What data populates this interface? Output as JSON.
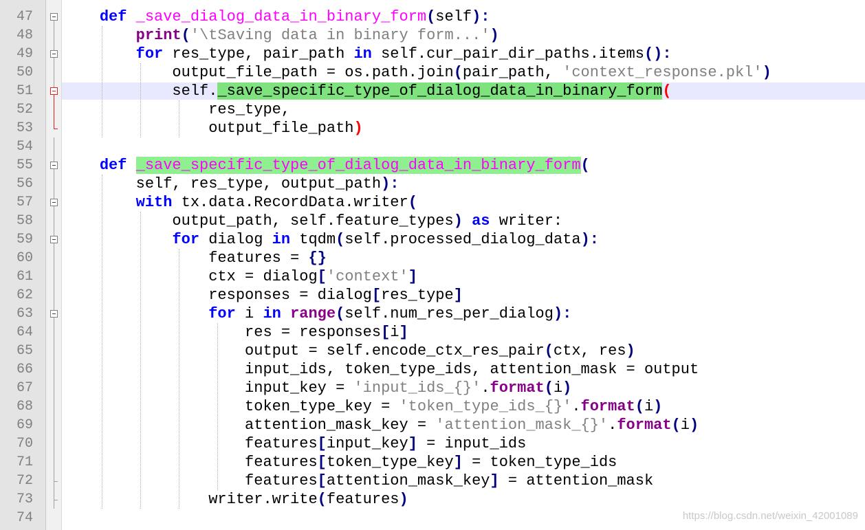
{
  "editor": {
    "current_line": 51,
    "lines": [
      {
        "n": "47",
        "fold": "open",
        "tokens": [
          {
            "t": "    "
          },
          {
            "t": "def",
            "c": "kw"
          },
          {
            "t": " "
          },
          {
            "t": "_save_dialog_data_in_binary_form",
            "c": "def"
          },
          {
            "t": "(",
            "c": "brace"
          },
          {
            "t": "self"
          },
          {
            "t": "):",
            "c": "brace"
          }
        ]
      },
      {
        "n": "48",
        "fold": "line",
        "tokens": [
          {
            "t": "        "
          },
          {
            "t": "print",
            "c": "kw2"
          },
          {
            "t": "(",
            "c": "brace"
          },
          {
            "t": "'\\tSaving data in binary form...'",
            "c": "str"
          },
          {
            "t": ")",
            "c": "brace"
          }
        ]
      },
      {
        "n": "49",
        "fold": "open",
        "tokens": [
          {
            "t": "        "
          },
          {
            "t": "for",
            "c": "kw"
          },
          {
            "t": " res_type, pair_path "
          },
          {
            "t": "in",
            "c": "kw"
          },
          {
            "t": " self.cur_pair_dir_paths.items"
          },
          {
            "t": "():",
            "c": "brace"
          }
        ]
      },
      {
        "n": "50",
        "fold": "line",
        "tokens": [
          {
            "t": "            output_file_path = os.path.join"
          },
          {
            "t": "(",
            "c": "brace"
          },
          {
            "t": "pair_path, "
          },
          {
            "t": "'context_response.pkl'",
            "c": "str"
          },
          {
            "t": ")",
            "c": "brace"
          }
        ]
      },
      {
        "n": "51",
        "fold": "open-red",
        "tokens": [
          {
            "t": "            self."
          },
          {
            "t": "_save_specific_type_of_dialog_data_in_binary_form",
            "c": "hl"
          },
          {
            "t": "(",
            "c": "brace-red"
          }
        ]
      },
      {
        "n": "52",
        "fold": "line-red",
        "tokens": [
          {
            "t": "                res_type,"
          }
        ]
      },
      {
        "n": "53",
        "fold": "end-red",
        "tokens": [
          {
            "t": "                output_file_path"
          },
          {
            "t": ")",
            "c": "brace-red"
          }
        ]
      },
      {
        "n": "54",
        "fold": "line",
        "tokens": []
      },
      {
        "n": "55",
        "fold": "open",
        "tokens": [
          {
            "t": "    "
          },
          {
            "t": "def",
            "c": "kw"
          },
          {
            "t": " "
          },
          {
            "t": "_save_specific_type_of_dialog_data_in_binary_form",
            "c": "def hl"
          },
          {
            "t": "(",
            "c": "brace"
          }
        ]
      },
      {
        "n": "56",
        "fold": "line",
        "tokens": [
          {
            "t": "        self, res_type, output_path"
          },
          {
            "t": "):",
            "c": "brace"
          }
        ]
      },
      {
        "n": "57",
        "fold": "open",
        "tokens": [
          {
            "t": "        "
          },
          {
            "t": "with",
            "c": "kw"
          },
          {
            "t": " tx.data.RecordData.writer"
          },
          {
            "t": "(",
            "c": "brace"
          }
        ]
      },
      {
        "n": "58",
        "fold": "line",
        "tokens": [
          {
            "t": "            output_path, self.feature_types"
          },
          {
            "t": ")",
            "c": "brace"
          },
          {
            "t": " "
          },
          {
            "t": "as",
            "c": "kw"
          },
          {
            "t": " writer:"
          }
        ]
      },
      {
        "n": "59",
        "fold": "open",
        "tokens": [
          {
            "t": "            "
          },
          {
            "t": "for",
            "c": "kw"
          },
          {
            "t": " dialog "
          },
          {
            "t": "in",
            "c": "kw"
          },
          {
            "t": " tqdm"
          },
          {
            "t": "(",
            "c": "brace"
          },
          {
            "t": "self.processed_dialog_data"
          },
          {
            "t": "):",
            "c": "brace"
          }
        ]
      },
      {
        "n": "60",
        "fold": "line",
        "tokens": [
          {
            "t": "                features = "
          },
          {
            "t": "{}",
            "c": "brace"
          }
        ]
      },
      {
        "n": "61",
        "fold": "line",
        "tokens": [
          {
            "t": "                ctx = dialog"
          },
          {
            "t": "[",
            "c": "brace"
          },
          {
            "t": "'context'",
            "c": "str"
          },
          {
            "t": "]",
            "c": "brace"
          }
        ]
      },
      {
        "n": "62",
        "fold": "line",
        "tokens": [
          {
            "t": "                responses = dialog"
          },
          {
            "t": "[",
            "c": "brace"
          },
          {
            "t": "res_type"
          },
          {
            "t": "]",
            "c": "brace"
          }
        ]
      },
      {
        "n": "63",
        "fold": "open",
        "tokens": [
          {
            "t": "                "
          },
          {
            "t": "for",
            "c": "kw"
          },
          {
            "t": " i "
          },
          {
            "t": "in",
            "c": "kw"
          },
          {
            "t": " "
          },
          {
            "t": "range",
            "c": "kw2"
          },
          {
            "t": "(",
            "c": "brace"
          },
          {
            "t": "self.num_res_per_dialog"
          },
          {
            "t": "):",
            "c": "brace"
          }
        ]
      },
      {
        "n": "64",
        "fold": "line",
        "tokens": [
          {
            "t": "                    res = responses"
          },
          {
            "t": "[",
            "c": "brace"
          },
          {
            "t": "i"
          },
          {
            "t": "]",
            "c": "brace"
          }
        ]
      },
      {
        "n": "65",
        "fold": "line",
        "tokens": [
          {
            "t": "                    output = self.encode_ctx_res_pair"
          },
          {
            "t": "(",
            "c": "brace"
          },
          {
            "t": "ctx, res"
          },
          {
            "t": ")",
            "c": "brace"
          }
        ]
      },
      {
        "n": "66",
        "fold": "line",
        "tokens": [
          {
            "t": "                    input_ids, token_type_ids, attention_mask = output"
          }
        ]
      },
      {
        "n": "67",
        "fold": "line",
        "tokens": [
          {
            "t": "                    input_key = "
          },
          {
            "t": "'input_ids_{}'",
            "c": "str"
          },
          {
            "t": "."
          },
          {
            "t": "format",
            "c": "kw2"
          },
          {
            "t": "(",
            "c": "brace"
          },
          {
            "t": "i"
          },
          {
            "t": ")",
            "c": "brace"
          }
        ]
      },
      {
        "n": "68",
        "fold": "line",
        "tokens": [
          {
            "t": "                    token_type_key = "
          },
          {
            "t": "'token_type_ids_{}'",
            "c": "str"
          },
          {
            "t": "."
          },
          {
            "t": "format",
            "c": "kw2"
          },
          {
            "t": "(",
            "c": "brace"
          },
          {
            "t": "i"
          },
          {
            "t": ")",
            "c": "brace"
          }
        ]
      },
      {
        "n": "69",
        "fold": "line",
        "tokens": [
          {
            "t": "                    attention_mask_key = "
          },
          {
            "t": "'attention_mask_{}'",
            "c": "str"
          },
          {
            "t": "."
          },
          {
            "t": "format",
            "c": "kw2"
          },
          {
            "t": "(",
            "c": "brace"
          },
          {
            "t": "i"
          },
          {
            "t": ")",
            "c": "brace"
          }
        ]
      },
      {
        "n": "70",
        "fold": "line",
        "tokens": [
          {
            "t": "                    features"
          },
          {
            "t": "[",
            "c": "brace"
          },
          {
            "t": "input_key"
          },
          {
            "t": "]",
            "c": "brace"
          },
          {
            "t": " = input_ids"
          }
        ]
      },
      {
        "n": "71",
        "fold": "line",
        "tokens": [
          {
            "t": "                    features"
          },
          {
            "t": "[",
            "c": "brace"
          },
          {
            "t": "token_type_key"
          },
          {
            "t": "]",
            "c": "brace"
          },
          {
            "t": " = token_type_ids"
          }
        ]
      },
      {
        "n": "72",
        "fold": "end",
        "tokens": [
          {
            "t": "                    features"
          },
          {
            "t": "[",
            "c": "brace"
          },
          {
            "t": "attention_mask_key"
          },
          {
            "t": "]",
            "c": "brace"
          },
          {
            "t": " = attention_mask"
          }
        ]
      },
      {
        "n": "73",
        "fold": "end",
        "tokens": [
          {
            "t": "                writer.write"
          },
          {
            "t": "(",
            "c": "brace"
          },
          {
            "t": "features"
          },
          {
            "t": ")",
            "c": "brace"
          }
        ]
      },
      {
        "n": "74",
        "fold": "none",
        "tokens": []
      }
    ]
  },
  "watermark": "https://blog.csdn.net/weixin_42001089"
}
